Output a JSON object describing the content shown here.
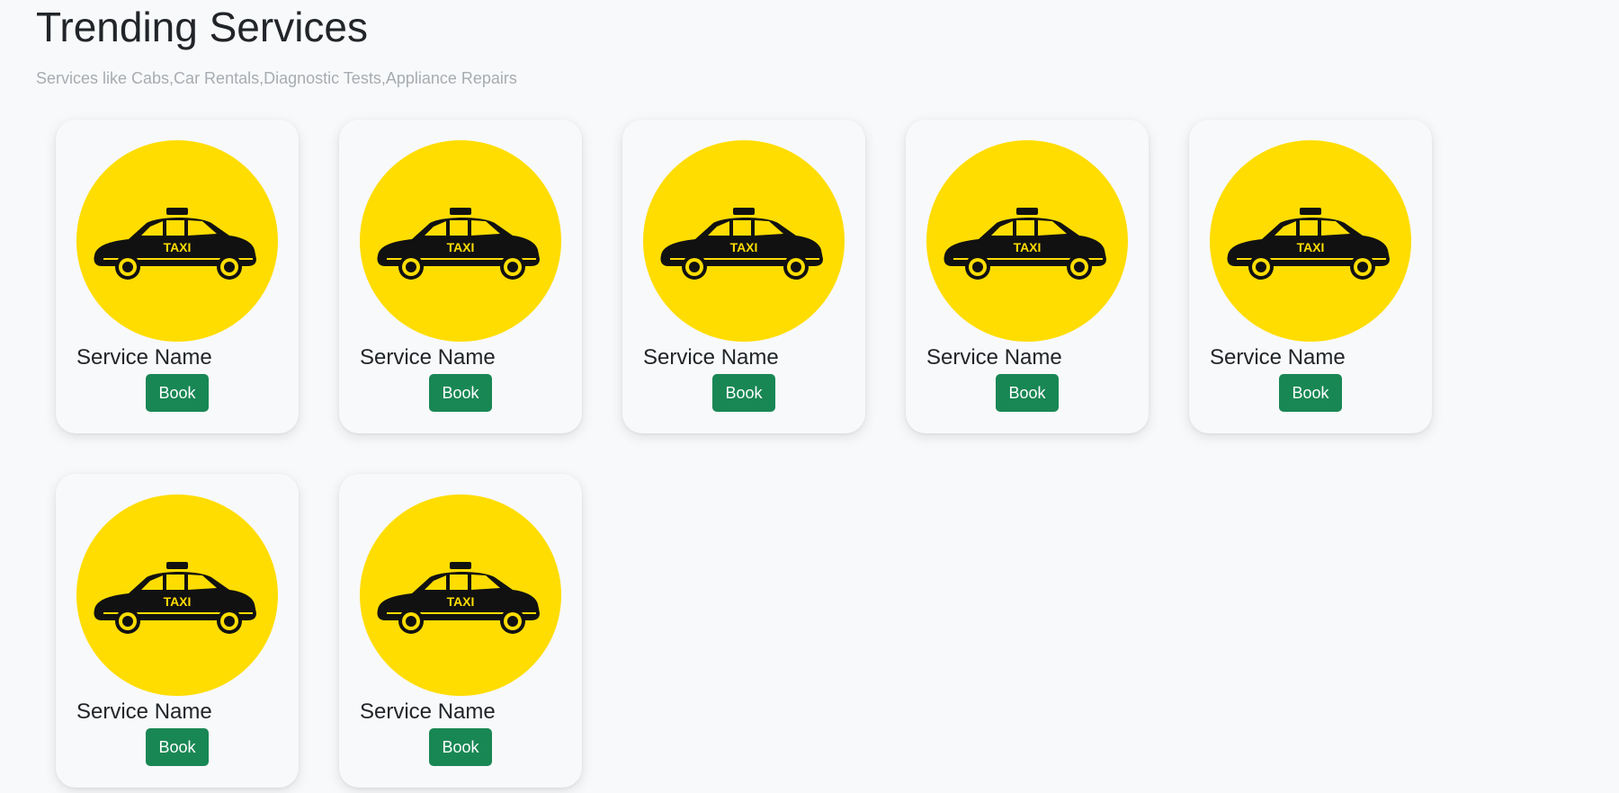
{
  "header": {
    "title": "Trending Services",
    "subtitle": "Services like Cabs,Car Rentals,Diagnostic Tests,Appliance Repairs"
  },
  "colors": {
    "accent_button": "#198754",
    "icon_background": "#ffdd00",
    "page_background": "#f8f9fa"
  },
  "services": [
    {
      "name": "Service Name",
      "button_label": "Book",
      "icon": "taxi-icon",
      "icon_text": "TAXI"
    },
    {
      "name": "Service Name",
      "button_label": "Book",
      "icon": "taxi-icon",
      "icon_text": "TAXI"
    },
    {
      "name": "Service Name",
      "button_label": "Book",
      "icon": "taxi-icon",
      "icon_text": "TAXI"
    },
    {
      "name": "Service Name",
      "button_label": "Book",
      "icon": "taxi-icon",
      "icon_text": "TAXI"
    },
    {
      "name": "Service Name",
      "button_label": "Book",
      "icon": "taxi-icon",
      "icon_text": "TAXI"
    },
    {
      "name": "Service Name",
      "button_label": "Book",
      "icon": "taxi-icon",
      "icon_text": "TAXI"
    },
    {
      "name": "Service Name",
      "button_label": "Book",
      "icon": "taxi-icon",
      "icon_text": "TAXI"
    }
  ]
}
